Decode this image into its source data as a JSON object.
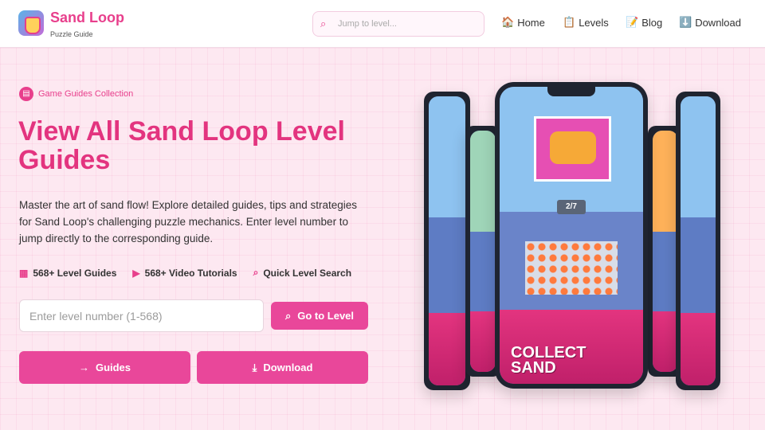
{
  "header": {
    "brand_title": "Sand Loop",
    "brand_subtitle": "Puzzle Guide",
    "search_placeholder": "Jump to level...",
    "nav": [
      {
        "icon": "house-icon",
        "glyph": "🏠",
        "label": "Home"
      },
      {
        "icon": "notebook-icon",
        "glyph": "📋",
        "label": "Levels"
      },
      {
        "icon": "memo-icon",
        "glyph": "📝",
        "label": "Blog"
      },
      {
        "icon": "download-arrow-icon",
        "glyph": "⬇️",
        "label": "Download"
      }
    ]
  },
  "hero": {
    "pill_label": "Game Guides Collection",
    "title": "View All Sand Loop Level Guides",
    "description": "Master the art of sand flow! Explore detailed guides, tips and strategies for Sand Loop's challenging puzzle mechanics. Enter level number to jump directly to the corresponding guide.",
    "features": [
      {
        "icon": "calendar-icon",
        "glyph": "▦",
        "label": "568+ Level Guides"
      },
      {
        "icon": "play-icon",
        "glyph": "▶",
        "label": "568+ Video Tutorials"
      },
      {
        "icon": "search-icon",
        "glyph": "⌕",
        "label": "Quick Level Search"
      }
    ],
    "level_input_placeholder": "Enter level number (1-568)",
    "go_button_label": "Go to Level",
    "guides_button_label": "Guides",
    "download_button_label": "Download"
  },
  "showcase": {
    "center_counter": "2/7",
    "center_banner": "COLLECT SAND"
  },
  "colors": {
    "accent": "#e83f8c",
    "button": "#e9479a",
    "hero_bg": "#fde8f1"
  }
}
